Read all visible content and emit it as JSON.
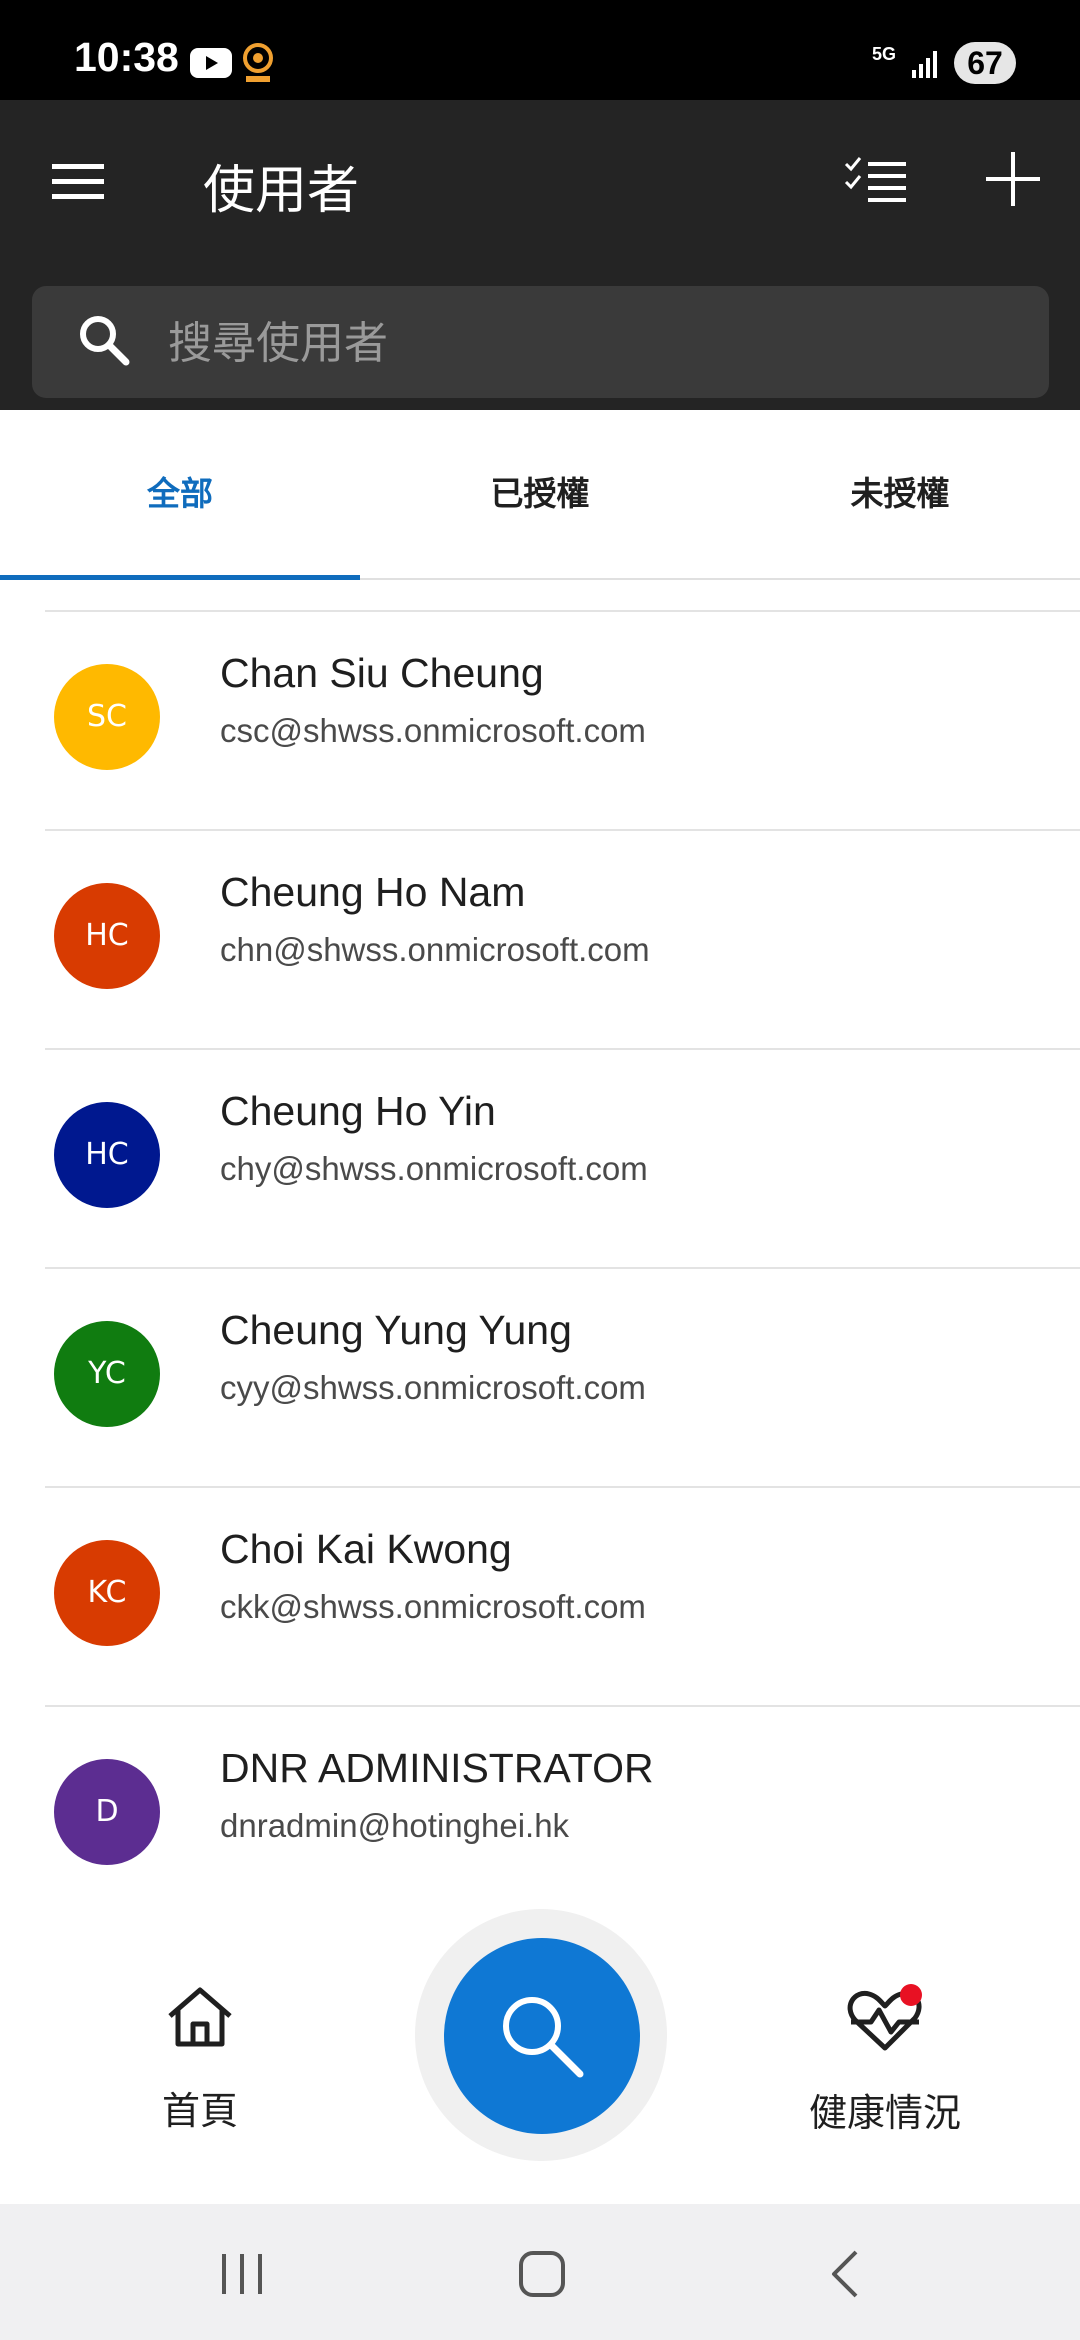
{
  "status_bar": {
    "time": "10:38",
    "network": "5G",
    "battery": "67",
    "icons": [
      "youtube-icon",
      "oncc-icon",
      "signal-icon"
    ]
  },
  "app_bar": {
    "title": "使用者",
    "menu_icon": "hamburger-menu-icon",
    "checklist_icon": "checklist-icon",
    "add_icon": "plus-icon"
  },
  "search": {
    "placeholder": "搜尋使用者",
    "value": ""
  },
  "tabs": [
    {
      "label": "全部",
      "active": true
    },
    {
      "label": "已授權",
      "active": false
    },
    {
      "label": "未授權",
      "active": false
    }
  ],
  "users": [
    {
      "initials": "SC",
      "name": "Chan Siu Cheung",
      "email": "csc@shwss.onmicrosoft.com",
      "color": "#ffb900"
    },
    {
      "initials": "HC",
      "name": "Cheung Ho Nam",
      "email": "chn@shwss.onmicrosoft.com",
      "color": "#d83b01"
    },
    {
      "initials": "HC",
      "name": "Cheung Ho Yin",
      "email": "chy@shwss.onmicrosoft.com",
      "color": "#00188f"
    },
    {
      "initials": "YC",
      "name": "Cheung Yung Yung",
      "email": "cyy@shwss.onmicrosoft.com",
      "color": "#107c10"
    },
    {
      "initials": "KC",
      "name": "Choi Kai Kwong",
      "email": "ckk@shwss.onmicrosoft.com",
      "color": "#d83b01"
    },
    {
      "initials": "D",
      "name": "DNR ADMINISTRATOR",
      "email": "dnradmin@hotinghei.hk",
      "color": "#5c2d91"
    }
  ],
  "bottom_nav": {
    "home_label": "首頁",
    "health_label": "健康情況"
  },
  "colors": {
    "accent": "#0f6cbd",
    "fab": "#0f78d4",
    "app_bar": "#242424",
    "notification_dot": "#e81123"
  }
}
